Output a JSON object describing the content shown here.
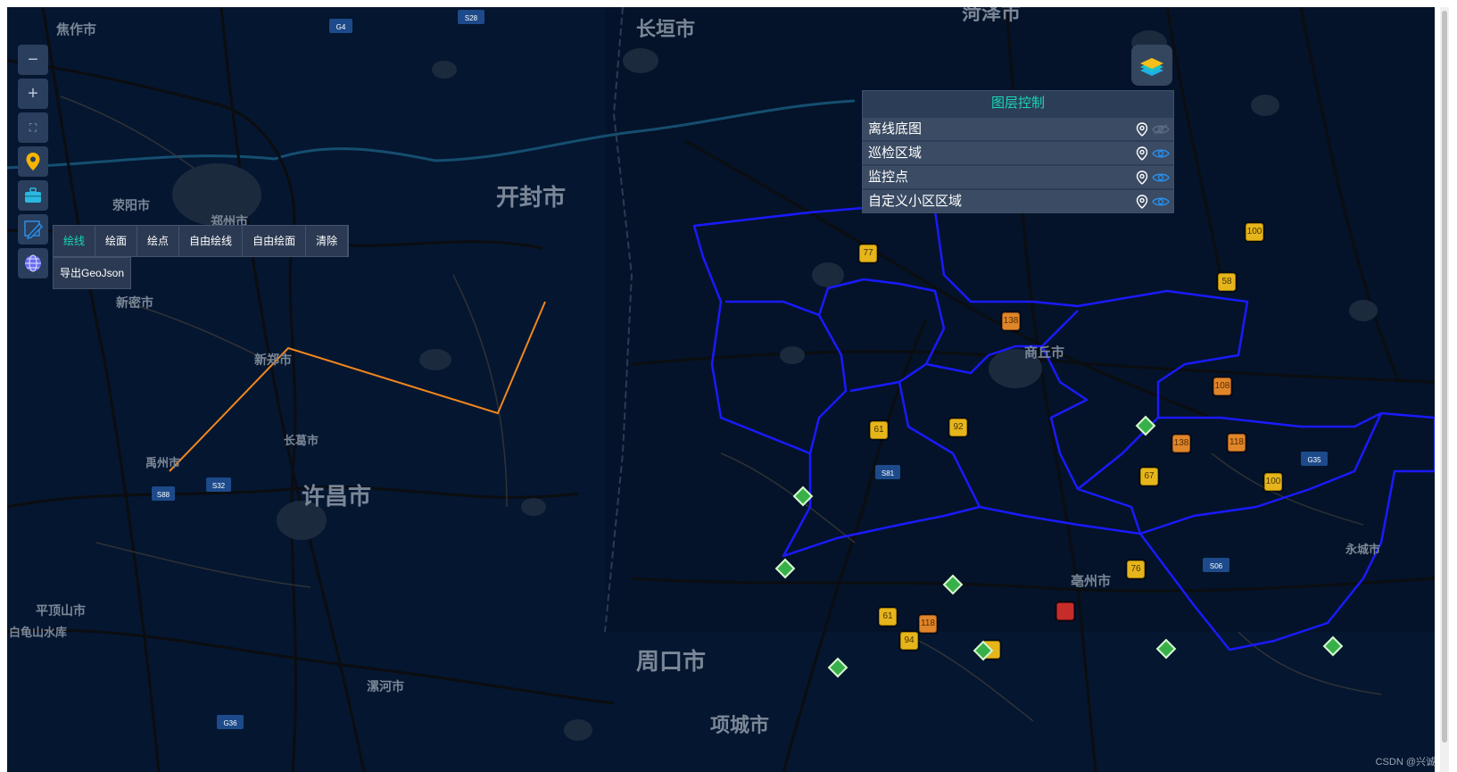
{
  "map": {
    "city_labels": [
      {
        "text": "焦作市",
        "size": 15
      },
      {
        "text": "长垣市",
        "size": 22
      },
      {
        "text": "菏泽市",
        "size": 22
      },
      {
        "text": "荥阳市",
        "size": 14
      },
      {
        "text": "郑州市",
        "size": 14
      },
      {
        "text": "开封市",
        "size": 26
      },
      {
        "text": "新密市",
        "size": 14
      },
      {
        "text": "新郑市",
        "size": 14
      },
      {
        "text": "长葛市",
        "size": 13
      },
      {
        "text": "禹州市",
        "size": 13
      },
      {
        "text": "许昌市",
        "size": 26
      },
      {
        "text": "商丘市",
        "size": 15
      },
      {
        "text": "平顶山市",
        "size": 14
      },
      {
        "text": "白龟山水库",
        "size": 13
      },
      {
        "text": "漯河市",
        "size": 14
      },
      {
        "text": "周口市",
        "size": 26
      },
      {
        "text": "亳州市",
        "size": 15
      },
      {
        "text": "永城市",
        "size": 13
      },
      {
        "text": "项城市",
        "size": 22
      }
    ],
    "road_shields": [
      "G4",
      "S28",
      "S88",
      "S32",
      "S81",
      "G35",
      "S06",
      "G36"
    ],
    "markers": {
      "count_yellow": [
        "77",
        "100",
        "58",
        "61",
        "92",
        "67",
        "100",
        "76",
        "61",
        "94"
      ],
      "count_orange": [
        "138",
        "108",
        "138",
        "118",
        "118"
      ],
      "count_red": [
        ""
      ],
      "camera_count": 8
    },
    "colors": {
      "background": "#051630",
      "boundary": "#1a1aff",
      "drawn_line": "#f0871e"
    }
  },
  "controls": {
    "zoom_out": "−",
    "zoom_in": "+",
    "fullscreen_icon": "fullscreen-icon",
    "location_icon": "location-pin-icon",
    "toolbox_icon": "toolbox-icon",
    "draw_icon": "draw-icon",
    "globe_icon": "globe-icon"
  },
  "draw_menu": {
    "items": [
      "绘线",
      "绘面",
      "绘点",
      "自由绘线",
      "自由绘面",
      "清除"
    ],
    "active": "绘线",
    "export": "导出GeoJson"
  },
  "layer_panel": {
    "title": "图层控制",
    "layers": [
      {
        "name": "离线底图",
        "visible": false
      },
      {
        "name": "巡检区域",
        "visible": true
      },
      {
        "name": "监控点",
        "visible": true
      },
      {
        "name": "自定义小区区域",
        "visible": true
      }
    ]
  },
  "watermark": "CSDN @兴诚"
}
